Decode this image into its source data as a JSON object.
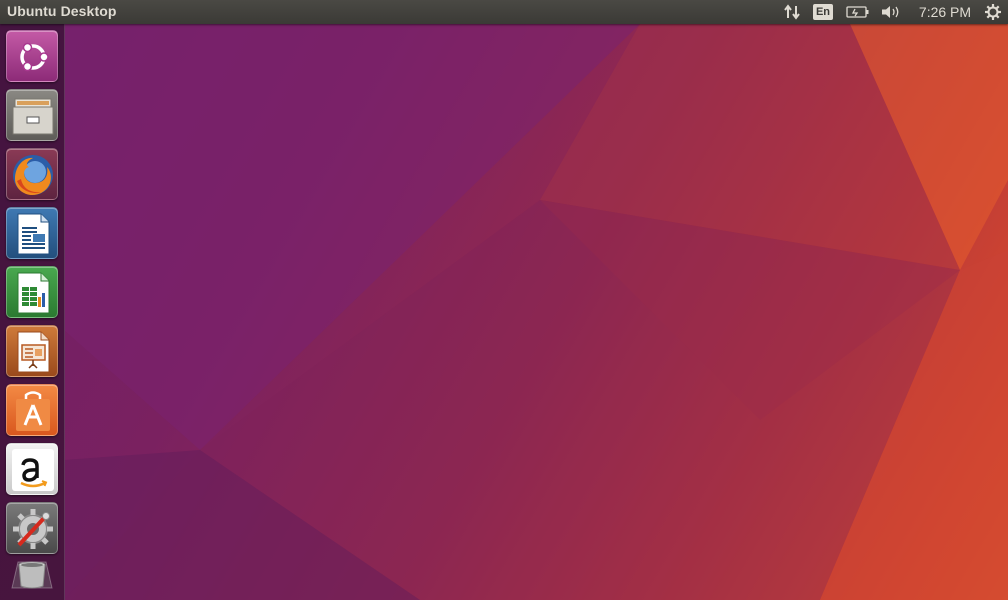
{
  "panel": {
    "title": "Ubuntu Desktop",
    "clock": "7:26 PM",
    "language": "En",
    "indicators": [
      "network-transfer-icon",
      "keyboard-language-indicator",
      "battery-icon",
      "volume-icon",
      "clock",
      "session-gear-icon"
    ]
  },
  "launcher": {
    "items": [
      {
        "name": "Dash Home",
        "icon": "ubuntu-logo-icon",
        "tile_color": "#b03a8c"
      },
      {
        "name": "Files",
        "icon": "file-cabinet-icon",
        "tile_color": "#6a6a66"
      },
      {
        "name": "Firefox Web Browser",
        "icon": "firefox-icon",
        "tile_color": "#5a2a3e"
      },
      {
        "name": "LibreOffice Writer",
        "icon": "writer-document-icon",
        "tile_color": "#2a5d8f"
      },
      {
        "name": "LibreOffice Calc",
        "icon": "calc-spreadsheet-icon",
        "tile_color": "#2e8a35"
      },
      {
        "name": "LibreOffice Impress",
        "icon": "impress-presentation-icon",
        "tile_color": "#b85a22"
      },
      {
        "name": "Ubuntu Software",
        "icon": "software-bag-icon",
        "tile_color": "#e86a2a"
      },
      {
        "name": "Amazon",
        "icon": "amazon-icon",
        "tile_color": "#d9d9d9"
      },
      {
        "name": "System Settings",
        "icon": "system-settings-icon",
        "tile_color": "#5a5a5a"
      },
      {
        "name": "Trash",
        "icon": "trash-icon",
        "tile_color": "#4a3a48"
      }
    ]
  },
  "colors": {
    "panel_bg": "#3b3a36",
    "panel_text": "#dfdbd2",
    "wallpaper_left": "#6e1f6a",
    "wallpaper_right": "#e0562a"
  }
}
